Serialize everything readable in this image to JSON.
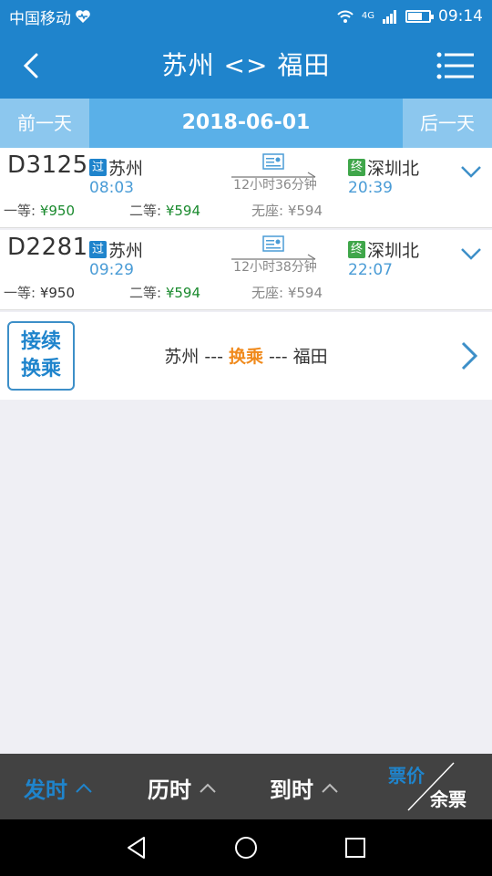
{
  "status": {
    "carrier": "中国移动",
    "network": "4G",
    "time": "09:14",
    "battery_level": 0.7
  },
  "header": {
    "title": "苏州 <> 福田"
  },
  "date_bar": {
    "prev_label": "前一天",
    "date": "2018-06-01",
    "next_label": "后一天"
  },
  "trains": [
    {
      "code": "D3125",
      "from_badge": "过",
      "from": "苏州",
      "dep_time": "08:03",
      "duration": "12小时36分钟",
      "to_badge": "终",
      "to": "深圳北",
      "arr_time": "20:39",
      "first_class_label": "一等:",
      "first_class_price": "¥950",
      "second_class_label": "二等:",
      "second_class_price": "¥594",
      "no_seat": "无座: ¥594"
    },
    {
      "code": "D2281",
      "from_badge": "过",
      "from": "苏州",
      "dep_time": "09:29",
      "duration": "12小时38分钟",
      "to_badge": "终",
      "to": "深圳北",
      "arr_time": "22:07",
      "first_class_label": "一等:",
      "first_class_price": "¥950",
      "second_class_label": "二等:",
      "second_class_price": "¥594",
      "no_seat": "无座: ¥594"
    }
  ],
  "transfer": {
    "badge_line1": "接续",
    "badge_line2": "换乘",
    "origin": "苏州",
    "sep1": " --- ",
    "middle": "换乘",
    "sep2": " --- ",
    "destination": "福田"
  },
  "sort_bar": {
    "depart_label": "发时",
    "duration_label": "历时",
    "arrive_label": "到时",
    "price_label": "票价",
    "remain_label": "余票",
    "active_color": "#1f84cc"
  },
  "colors": {
    "brand": "#1f84cc",
    "price_green": "#1a8a2e",
    "transfer_orange": "#f08a1c"
  }
}
